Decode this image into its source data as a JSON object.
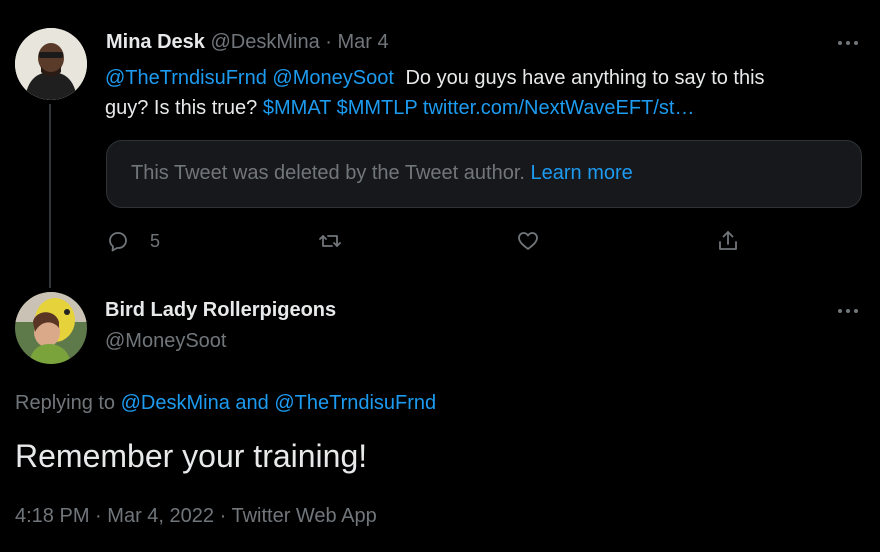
{
  "tweet1": {
    "display_name": "Mina Desk",
    "handle": "@DeskMina",
    "separator": "·",
    "date": "Mar 4",
    "mention1": "@TheTrndisuFrnd",
    "mention2": "@MoneySoot",
    "text_part1": "Do you guys have anything to say to this",
    "text_part2": "guy? Is this true?",
    "cashtag1": "$MMAT",
    "cashtag2": "$MMTLP",
    "link": "twitter.com/NextWaveEFT/st…",
    "deleted_notice": "This Tweet was deleted by the Tweet author.",
    "learn_more": "Learn more",
    "reply_count": "5"
  },
  "tweet2": {
    "display_name": "Bird Lady Rollerpigeons",
    "handle": "@MoneySoot",
    "replying_prefix": "Replying to",
    "replying_user1": "@DeskMina",
    "replying_and": "and",
    "replying_user2": "@TheTrndisuFrnd",
    "text": "Remember your training!",
    "time": "4:18 PM",
    "separator1": "·",
    "date": "Mar 4, 2022",
    "separator2": "·",
    "source": "Twitter Web App"
  },
  "icons": {
    "more": "more-horizontal-icon",
    "reply": "reply-icon",
    "retweet": "retweet-icon",
    "like": "heart-icon",
    "share": "share-icon"
  },
  "colors": {
    "background": "#000000",
    "text": "#e7e9ea",
    "muted": "#71767b",
    "link": "#1d9bf0"
  }
}
